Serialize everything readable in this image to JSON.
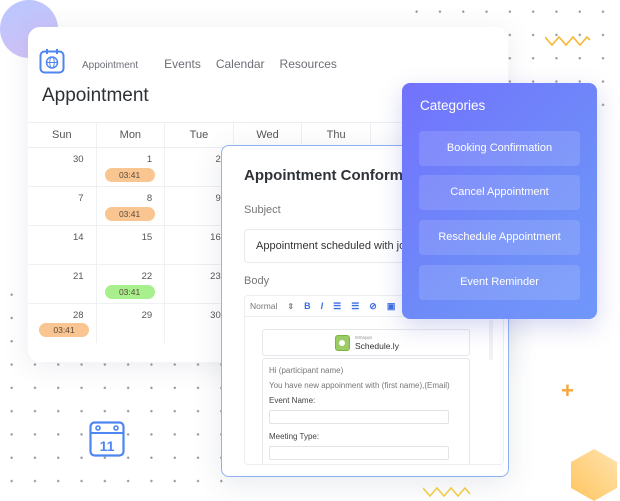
{
  "app": {
    "nav": [
      "Appointment",
      "Events",
      "Calendar",
      "Resources"
    ],
    "title": "Appointment"
  },
  "calendar": {
    "weekdays": [
      "Sun",
      "Mon",
      "Tue",
      "Wed",
      "Thu"
    ],
    "rows": [
      [
        "30",
        "1",
        "2"
      ],
      [
        "7",
        "8",
        "9"
      ],
      [
        "14",
        "15",
        "16"
      ],
      [
        "21",
        "22",
        "23"
      ],
      [
        "28",
        "29",
        "30"
      ]
    ],
    "events": [
      {
        "time": "03:41",
        "color": "#f9c590"
      },
      {
        "time": "03:41",
        "color": "#f9c590"
      },
      {
        "time": "03:41",
        "color": "#a8f08e"
      },
      {
        "time": "03:41",
        "color": "#f9c590"
      }
    ]
  },
  "dialog": {
    "title": "Appointment Conformation",
    "subject_label": "Subject",
    "subject_value": "Appointment scheduled with john",
    "body_label": "Body",
    "toolbar": {
      "format": "Normal",
      "icons": [
        "format-select-arrows-icon",
        "bold-icon",
        "italic-icon",
        "ordered-list-icon",
        "bullet-list-icon",
        "link-icon",
        "image-icon"
      ]
    },
    "logo": {
      "small": "500apps",
      "name": "Schedule.ly"
    },
    "mail": {
      "greeting": "Hi (participant name)",
      "line": "You have new appoinment with (first name),(Email)",
      "fields": [
        "Event Name:",
        "Meeting Type:"
      ]
    }
  },
  "categories": {
    "title": "Categories",
    "items": [
      "Booking Confirmation",
      "Cancel Appointment",
      "Reschedule Appointment",
      "Event Reminder"
    ]
  },
  "decor": {
    "calendar_icon_day": "11",
    "plus": "+",
    "accent_blue": "#4d86f0",
    "accent_orange": "#f6a63a",
    "panel_purple": "#7272fd"
  }
}
